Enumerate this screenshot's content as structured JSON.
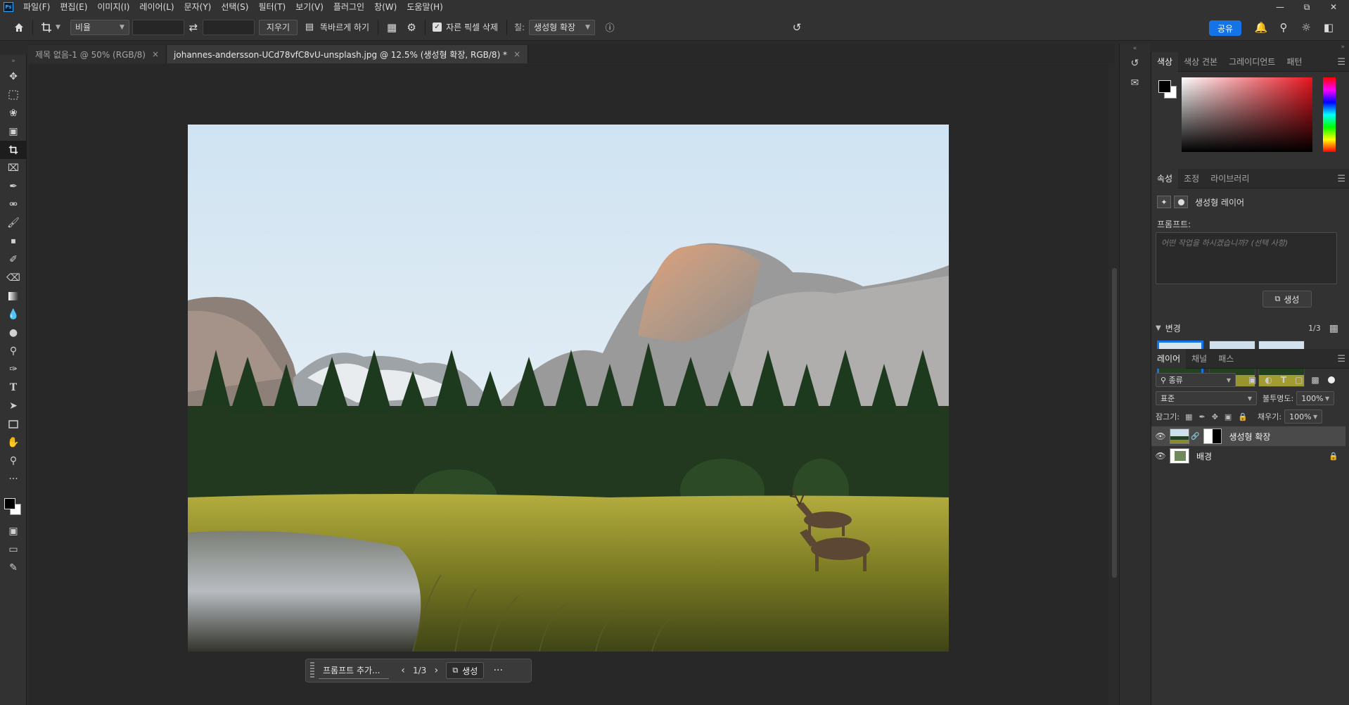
{
  "app": {
    "logo": "Ps",
    "menus": [
      "파일(F)",
      "편집(E)",
      "이미지(I)",
      "레이어(L)",
      "문자(Y)",
      "선택(S)",
      "필터(T)",
      "보기(V)",
      "플러그인",
      "창(W)",
      "도움말(H)"
    ]
  },
  "options": {
    "ratio_select": "비율",
    "clear_label": "지우기",
    "straighten_label": "똑바르게 하기",
    "delete_cropped_label": "자른 픽셀 삭제",
    "fill_label": "칠:",
    "fill_select": "생성형 확장",
    "share_label": "공유"
  },
  "tabs": [
    {
      "label": "제목 없음-1 @ 50% (RGB/8)",
      "close": "×"
    },
    {
      "label": "johannes-andersson-UCd78vfC8vU-unsplash.jpg @ 12.5% (생성형 확장, RGB/8) *",
      "close": "×"
    }
  ],
  "context_bar": {
    "prompt_placeholder": "프롬프트 추가...",
    "counter": "1/3",
    "generate_label": "생성",
    "more": "···"
  },
  "color_panel": {
    "tabs": [
      "색상",
      "색상 견본",
      "그레이디언트",
      "패턴"
    ]
  },
  "properties": {
    "tabs": [
      "속성",
      "조정",
      "라이브러리"
    ],
    "layer_type": "생성형 레이어",
    "prompt_label": "프롬프트:",
    "prompt_placeholder": "어떤 작업을 하시겠습니까? (선택 사항)",
    "generate_label": "생성",
    "variations_label": "변경",
    "variations_counter": "1/3"
  },
  "layers_panel": {
    "tabs": [
      "레이어",
      "채널",
      "패스"
    ],
    "filter_select": "종류",
    "blend_mode": "표준",
    "opacity_label": "불투명도:",
    "opacity_value": "100%",
    "lock_label": "잠그기:",
    "fill_label": "채우기:",
    "fill_value": "100%",
    "layers": [
      {
        "name": "생성형 확장",
        "selected": true
      },
      {
        "name": "배경",
        "selected": false
      }
    ]
  },
  "colors": {
    "accent": "#1473e6",
    "panel_bg": "#323232",
    "canvas_bg": "#282828"
  }
}
